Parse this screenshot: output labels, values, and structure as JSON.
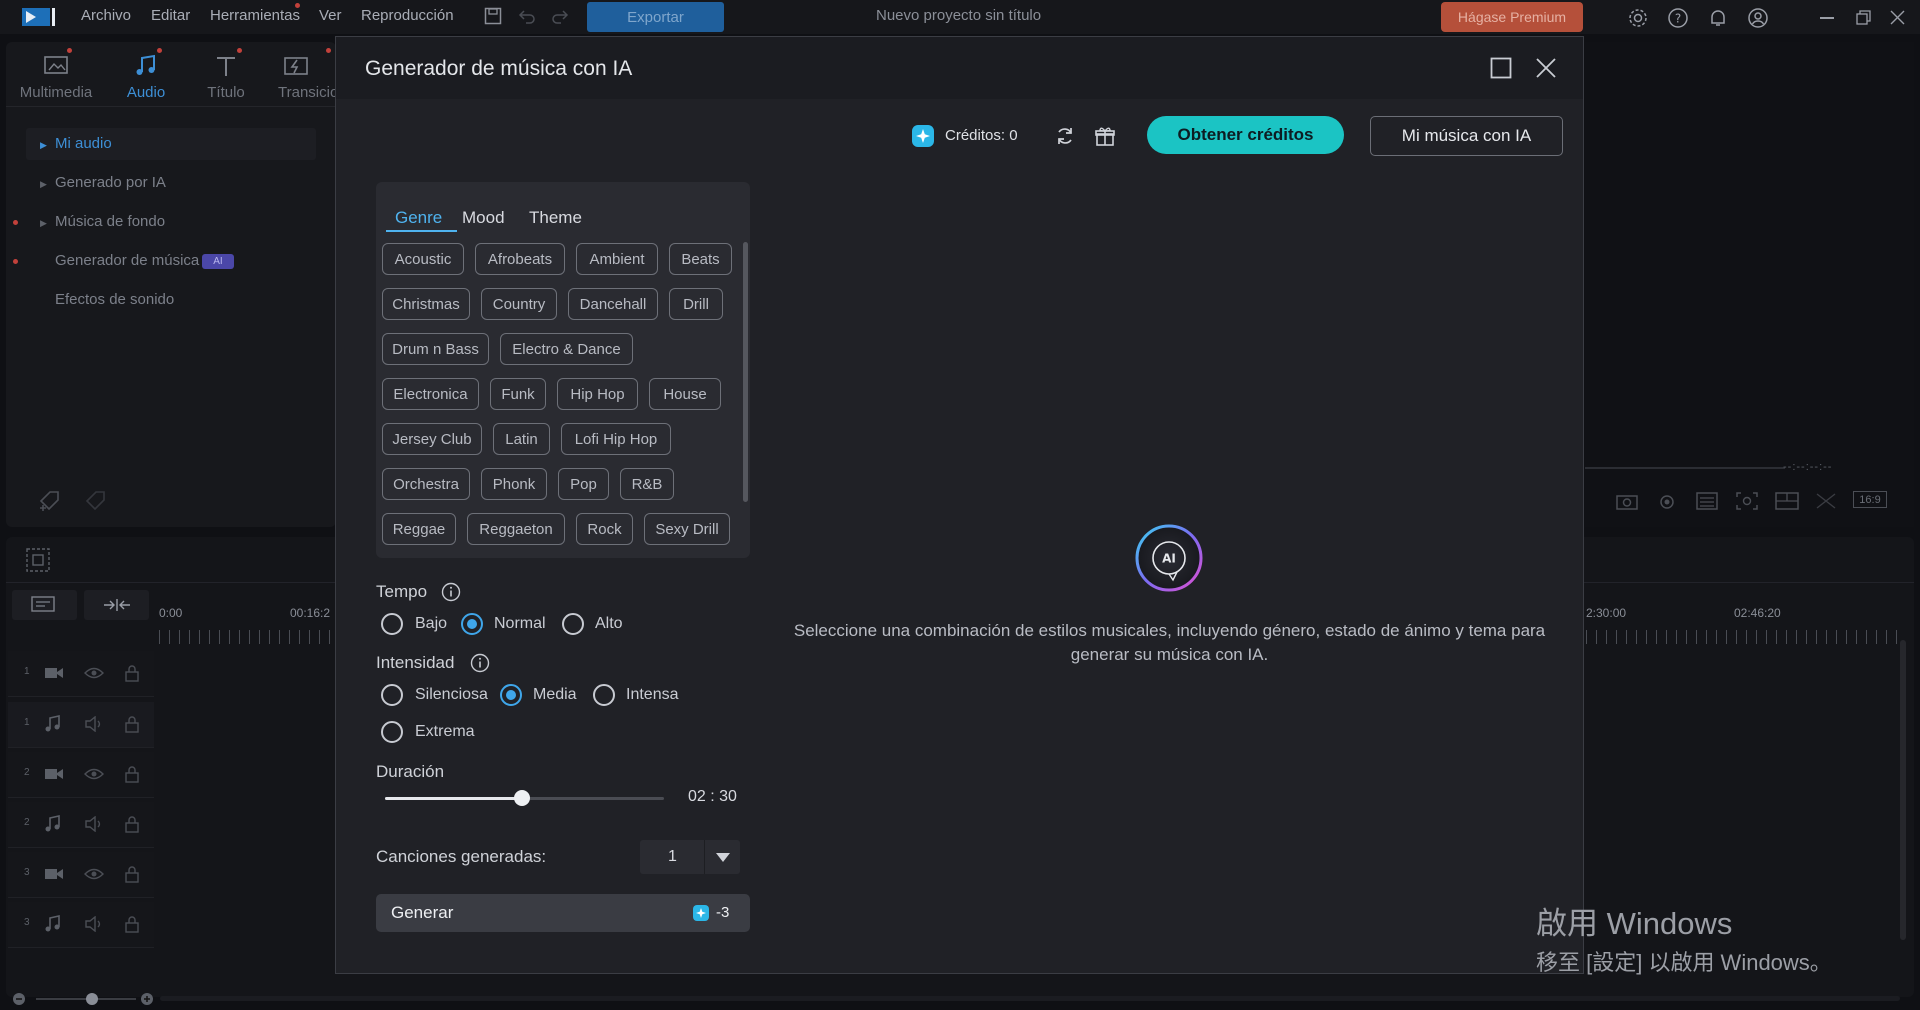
{
  "menubar": {
    "items": [
      "Archivo",
      "Editar",
      "Herramientas",
      "Ver",
      "Reproducción"
    ],
    "export_label": "Exportar",
    "project_title": "Nuevo proyecto sin título",
    "premium_label": "Hágase Premium"
  },
  "library": {
    "tabs": [
      "Multimedia",
      "Audio",
      "Título",
      "Transicio"
    ],
    "active_tab": "Audio",
    "items": [
      "Mi audio",
      "Generado por IA",
      "Música de fondo",
      "Generador de música",
      "Efectos de sonido"
    ],
    "ai_badge": "AI"
  },
  "timeline": {
    "times": [
      "0:00",
      "00:16:2",
      "2:30:00",
      "02:46:20"
    ],
    "tracks": [
      "1",
      "1",
      "2",
      "2",
      "3",
      "3"
    ],
    "timecode": "--:--:--:--",
    "aspect": "16:9"
  },
  "modal": {
    "title": "Generador de música con IA",
    "credits_label": "Créditos: 0",
    "get_credits_label": "Obtener créditos",
    "my_music_label": "Mi música con IA",
    "style_tabs": [
      "Genre",
      "Mood",
      "Theme"
    ],
    "active_style_tab": "Genre",
    "genres": [
      [
        "Acoustic",
        "Afrobeats",
        "Ambient",
        "Beats"
      ],
      [
        "Christmas",
        "Country",
        "Dancehall",
        "Drill"
      ],
      [
        "Drum n Bass",
        "Electro & Dance"
      ],
      [
        "Electronica",
        "Funk",
        "Hip Hop",
        "House"
      ],
      [
        "Jersey Club",
        "Latin",
        "Lofi Hip Hop"
      ],
      [
        "Orchestra",
        "Phonk",
        "Pop",
        "R&B"
      ],
      [
        "Reggae",
        "Reggaeton",
        "Rock",
        "Sexy Drill"
      ]
    ],
    "tempo": {
      "label": "Tempo",
      "options": [
        "Bajo",
        "Normal",
        "Alto"
      ],
      "selected": "Normal"
    },
    "intensity": {
      "label": "Intensidad",
      "options": [
        "Silenciosa",
        "Media",
        "Intensa",
        "Extrema"
      ],
      "selected": "Media"
    },
    "duration": {
      "label": "Duración",
      "value": "02 : 30",
      "fraction": 0.49
    },
    "songs": {
      "label": "Canciones generadas:",
      "value": "1"
    },
    "generate": {
      "label": "Generar",
      "cost": "-3"
    },
    "empty_message": "Seleccione una combinación de estilos musicales, incluyendo género, estado de ánimo y tema para generar su música con IA.",
    "orb_text": "AI"
  },
  "watermark": {
    "line1": "啟用 Windows",
    "line2": "移至 [設定] 以啟用 Windows。"
  },
  "colors": {
    "accent": "#1bc4c4",
    "selection": "#3fa6ea",
    "premium": "#b5503a"
  }
}
